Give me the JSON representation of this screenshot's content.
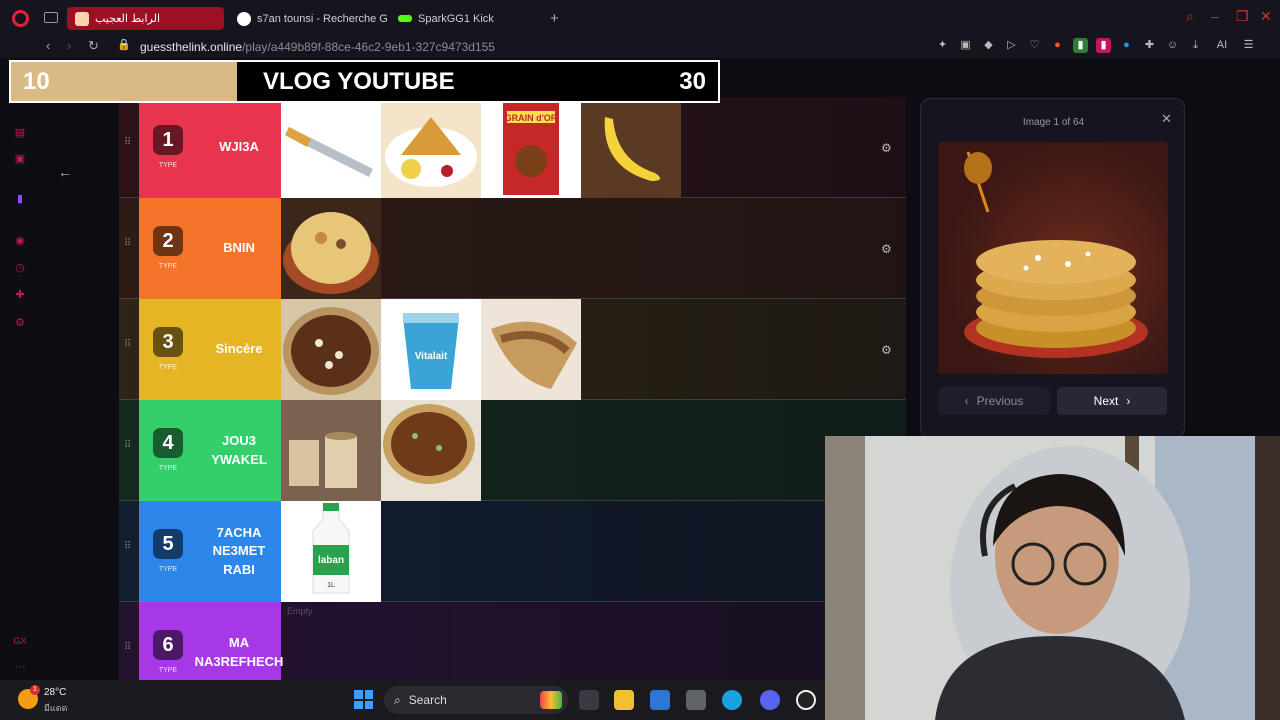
{
  "browser": {
    "tabs": [
      {
        "title": "الرابط العجيب",
        "active": true
      },
      {
        "title": "s7an tounsi - Recherche G",
        "active": false
      },
      {
        "title": "SparkGG1 Kick",
        "active": false
      }
    ],
    "url_host": "guessthelink.online",
    "url_path": "/play/a449b89f-88ce-46c2-9eb1-327c9473d155",
    "new_tab": "+"
  },
  "banner": {
    "left": "10",
    "title": "VLOG YOUTUBE",
    "right": "30",
    "fill_fraction": 0.32
  },
  "tierlist": {
    "type_label": "TYPE",
    "empty_label": "Empty",
    "rows": [
      {
        "num": "1",
        "label": "WJI3A",
        "color": "#e8344e",
        "accent": "#e8344e",
        "images": [
          "knife",
          "crepe",
          "cereal",
          "banana"
        ]
      },
      {
        "num": "2",
        "label": "BNIN",
        "color": "#f4742a",
        "accent": "#f4742a",
        "images": [
          "couscous"
        ]
      },
      {
        "num": "3",
        "label": "Sincère",
        "color": "#e6b526",
        "accent": "#e6b526",
        "images": [
          "dates",
          "yogurt",
          "sandwich"
        ]
      },
      {
        "num": "4",
        "label": "JOU3 YWAKEL",
        "color": "#34cf6b",
        "accent": "#34cf6b",
        "images": [
          "dessert",
          "tart"
        ]
      },
      {
        "num": "5",
        "label": "7ACHA NE3MET RABI",
        "color": "#2d86ea",
        "accent": "#2d86ea",
        "images": [
          "laban"
        ]
      },
      {
        "num": "6",
        "label": "MA NA3REFHECH",
        "color": "#a638e6",
        "accent": "#a638e6",
        "images": []
      }
    ]
  },
  "panel": {
    "count": "Image 1 of 64",
    "prev": "Previous",
    "next": "Next"
  },
  "image_text": {
    "cereal": "GRAIN d'OR",
    "yogurt": "Vitalait",
    "laban": "laban",
    "laban_vol": "1L"
  },
  "taskbar": {
    "temp": "28°C",
    "condition": "มีแดด",
    "search": "Search",
    "badge": "1"
  },
  "colors": {
    "accent": "#9b1025"
  }
}
